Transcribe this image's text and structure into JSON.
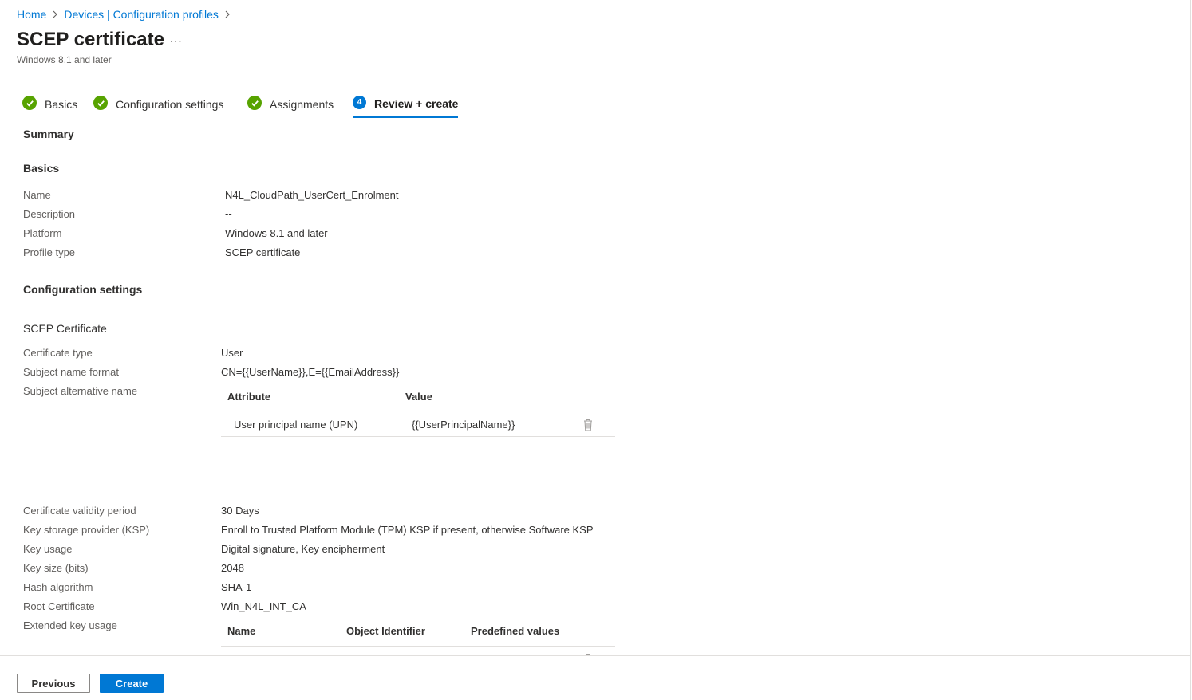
{
  "breadcrumb": [
    "Home",
    "Devices | Configuration profiles"
  ],
  "header": {
    "title": "SCEP certificate",
    "more": "...",
    "subtitle": "Windows 8.1 and later"
  },
  "steps": [
    {
      "label": "Basics",
      "status": "complete"
    },
    {
      "label": "Configuration settings",
      "status": "complete"
    },
    {
      "label": "Assignments",
      "status": "complete"
    },
    {
      "label": "Review + create",
      "status": "current",
      "number": "4"
    }
  ],
  "summary": {
    "heading": "Summary",
    "basics_heading": "Basics",
    "basics": [
      {
        "label": "Name",
        "value": "N4L_CloudPath_UserCert_Enrolment"
      },
      {
        "label": "Description",
        "value": "--"
      },
      {
        "label": "Platform",
        "value": "Windows 8.1 and later"
      },
      {
        "label": "Profile type",
        "value": "SCEP certificate"
      }
    ],
    "config_heading": "Configuration settings",
    "scep_heading": "SCEP Certificate",
    "settings_top": [
      {
        "label": "Certificate type",
        "value": "User"
      },
      {
        "label": "Subject name format",
        "value": "CN={{UserName}},E={{EmailAddress}}"
      },
      {
        "label": "Subject alternative name",
        "value": ""
      }
    ],
    "san_table": {
      "headers": [
        "Attribute",
        "Value"
      ],
      "rows": [
        {
          "attribute": "User principal name (UPN)",
          "value": "{{UserPrincipalName}}"
        }
      ]
    },
    "settings_bottom": [
      {
        "label": "Certificate validity period",
        "value": "30 Days"
      },
      {
        "label": "Key storage provider (KSP)",
        "value": "Enroll to Trusted Platform Module (TPM) KSP if present, otherwise Software KSP"
      },
      {
        "label": "Key usage",
        "value": "Digital signature, Key encipherment"
      },
      {
        "label": "Key size (bits)",
        "value": "2048"
      },
      {
        "label": "Hash algorithm",
        "value": "SHA-1"
      },
      {
        "label": "Root Certificate",
        "value": "Win_N4L_INT_CA"
      },
      {
        "label": "Extended key usage",
        "value": ""
      }
    ],
    "eku_table": {
      "headers": [
        "Name",
        "Object Identifier",
        "Predefined values"
      ]
    }
  },
  "footer": {
    "previous": "Previous",
    "create": "Create"
  },
  "icons": {
    "check": "checkmark-icon",
    "delete": "trash-icon",
    "chevron": "chevron-right-icon"
  },
  "colors": {
    "accent": "#0078d4",
    "success": "#57a300"
  }
}
